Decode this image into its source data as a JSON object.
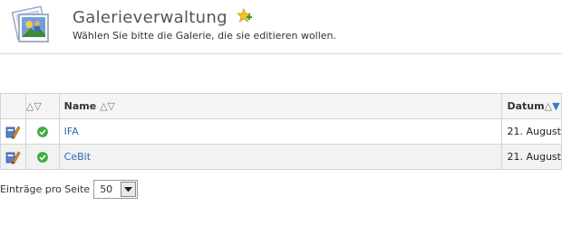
{
  "header": {
    "title": "Galerieverwaltung",
    "subtitle": "Wählen Sie bitte die Galerie, die sie editieren wollen.",
    "icon": "gallery-pictures-icon",
    "add_icon": "add-star-icon"
  },
  "table": {
    "columns": [
      {
        "key": "edit",
        "label": ""
      },
      {
        "key": "status",
        "label": "",
        "sort": "△▽"
      },
      {
        "key": "name",
        "label": "Name",
        "sort": "△▽"
      },
      {
        "key": "date",
        "label": "Datum",
        "sort_up": "△",
        "sort_down": "▼"
      }
    ],
    "rows": [
      {
        "edit_icon": "edit-gallery-icon",
        "status_icon": "active-check-icon",
        "name": "IFA",
        "date": "21. August"
      },
      {
        "edit_icon": "edit-gallery-icon",
        "status_icon": "active-check-icon",
        "name": "CeBit",
        "date": "21. August"
      }
    ]
  },
  "pagination": {
    "label": "Einträge pro Seite",
    "per_page": "50"
  },
  "colors": {
    "link": "#2e6ab1",
    "active_sort": "#3a7dc9",
    "status_ok": "#3cb43c"
  }
}
